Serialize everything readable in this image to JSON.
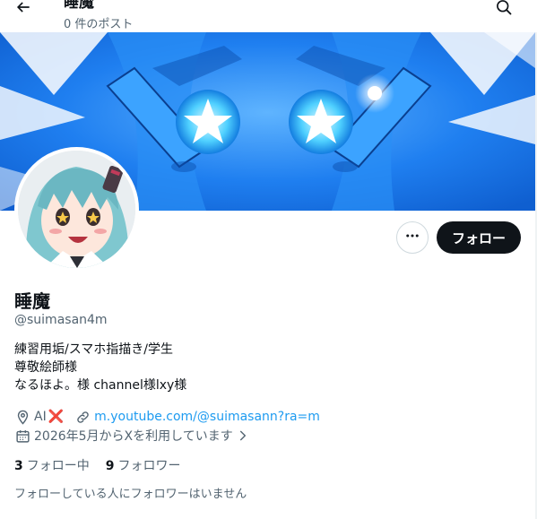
{
  "header": {
    "title": "睡魔",
    "post_count_label": "0 件のポスト"
  },
  "profile": {
    "display_name": "睡魔",
    "handle": "@suimasan4m",
    "bio_lines": [
      "練習用垢/スマホ指描き/学生",
      "尊敬絵師様",
      "なるほよ。様 channel様lxy様"
    ],
    "location": "AI",
    "location_mark": "❌",
    "website": "m.youtube.com/@suimasann?ra=m",
    "joined": "2026年5月からXを利用しています"
  },
  "actions": {
    "follow_label": "フォロー"
  },
  "stats": {
    "following_count": "3",
    "following_label": "フォロー中",
    "followers_count": "9",
    "followers_label": "フォロワー"
  },
  "notice": "フォローしている人にフォロワーはいません",
  "colors": {
    "accent": "#1d9bf0",
    "text_primary": "#0f1419",
    "text_secondary": "#536471",
    "button_dark": "#0f1419",
    "banner_blue": "#1f7ff0"
  },
  "icons": {
    "back": "arrow-left-icon",
    "search": "search-icon",
    "more": "more-dots-icon",
    "location": "location-pin-icon",
    "link": "link-icon",
    "calendar": "calendar-icon"
  }
}
